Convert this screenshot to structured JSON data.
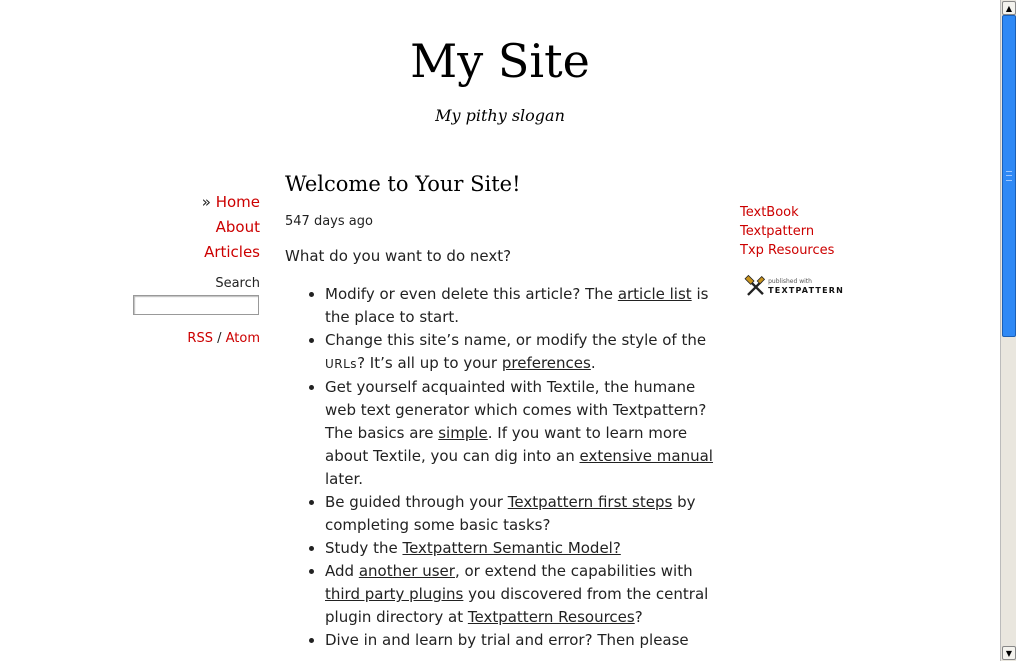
{
  "header": {
    "site_title": "My Site",
    "slogan": "My pithy slogan"
  },
  "nav": {
    "current_marker": "»",
    "items": [
      {
        "label": "Home"
      },
      {
        "label": "About"
      },
      {
        "label": "Articles"
      }
    ]
  },
  "search": {
    "label": "Search",
    "value": ""
  },
  "feeds": {
    "rss": "RSS",
    "separator": " / ",
    "atom": "Atom"
  },
  "article": {
    "title": "Welcome to Your Site!",
    "date": "547 days ago",
    "intro": "What do you want to do next?",
    "bullets": {
      "b1": {
        "t1": "Modify or even delete this article? The ",
        "link": "article list",
        "t2": " is the place to start."
      },
      "b2": {
        "t1": "Change this site’s name, or modify the style of the ",
        "sc": "URLs",
        "t2": "? It’s all up to your ",
        "link": "preferences",
        "t3": "."
      },
      "b3": {
        "t1": "Get yourself acquainted with Textile, the humane web text generator which comes with Textpattern? The basics are ",
        "link1": "simple",
        "t2": ". If you want to learn more about Textile, you can dig into an ",
        "link2": "extensive manual",
        "t3": " later."
      },
      "b4": {
        "t1": "Be guided through your ",
        "link": "Textpattern first steps",
        "t2": " by completing some basic tasks?"
      },
      "b5": {
        "t1": "Study the ",
        "link": "Textpattern Semantic Model?"
      },
      "b6": {
        "t1": "Add ",
        "link1": "another user",
        "t2": ", or extend the capabilities with ",
        "link2": "third party plugins",
        "t3": " you discovered from the central plugin directory at ",
        "link3": "Textpattern Resources",
        "t4": "?"
      },
      "b7": {
        "t1": "Dive in and learn by trial and error? Then please"
      }
    }
  },
  "sidebar_links": [
    {
      "label": "TextBook"
    },
    {
      "label": "Textpattern"
    },
    {
      "label": "Txp Resources"
    }
  ],
  "badge": {
    "small": "published with",
    "big": "TEXTPATTERN"
  },
  "colors": {
    "link": "#cc0000",
    "scroll_thumb": "#2f89f5"
  }
}
